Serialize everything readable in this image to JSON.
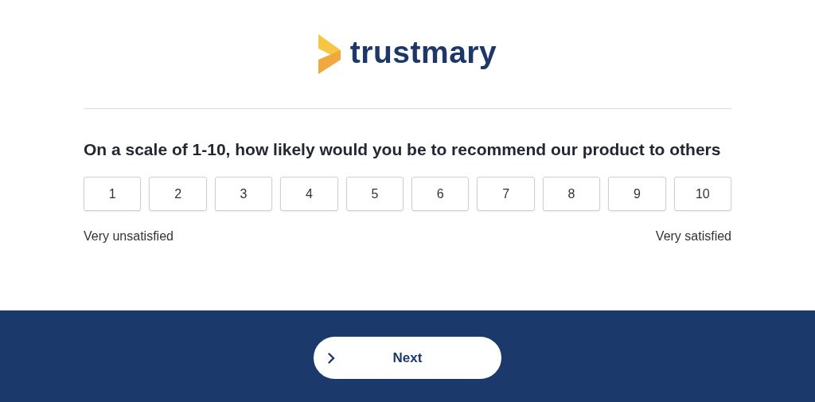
{
  "logo": {
    "text": "trustmary"
  },
  "question": "On a scale of 1-10, how likely would you be to recommend our product to others",
  "options": [
    {
      "label": "1",
      "selected": false
    },
    {
      "label": "2",
      "selected": false
    },
    {
      "label": "3",
      "selected": false
    },
    {
      "label": "4",
      "selected": false
    },
    {
      "label": "5",
      "selected": false
    },
    {
      "label": "6",
      "selected": false
    },
    {
      "label": "7",
      "selected": false
    },
    {
      "label": "8",
      "selected": false
    },
    {
      "label": "9",
      "selected": false
    },
    {
      "label": "10",
      "selected": false
    }
  ],
  "scale_labels": {
    "low": "Very unsatisfied",
    "high": "Very satisfied"
  },
  "next_button": {
    "label": "Next"
  }
}
